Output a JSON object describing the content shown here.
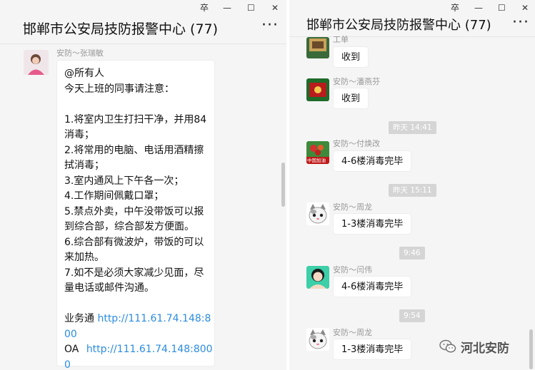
{
  "left_window": {
    "title": "邯郸市公安局技防报警中心 (77)",
    "controls": {
      "pin": "卒",
      "minimize": "—",
      "maximize": "☐",
      "close": "✕"
    },
    "more": "···",
    "message": {
      "sender": "安防～张瑞敏",
      "lines": [
        "@所有人",
        "今天上班的同事请注意：",
        "",
        "1.将室内卫生打扫干净，并用84",
        "消毒；",
        "2.将常用的电脑、电话用酒精擦",
        "拭消毒；",
        "3.室内通风上下午各一次；",
        "4.工作期间佩戴口罩；",
        "5.禁点外卖，中午没带饭可以报",
        "到综合部，综合部发方便面。",
        "6.综合部有微波炉，带饭的可以",
        "来加热。",
        "7.如不是必须大家减少见面，尽",
        "量电话或邮件沟通。",
        ""
      ],
      "link1_label": "业务通",
      "link1_url_a": "http://111.61.74.148:8",
      "link1_url_b": "00",
      "link2_label": "OA",
      "link2_url_a": "http://111.61.74.148:800",
      "link2_url_b": "0"
    }
  },
  "right_window": {
    "title": "邯郸市公安局技防报警中心 (77)",
    "controls": {
      "pin": "卒",
      "minimize": "—",
      "maximize": "☐",
      "close": "✕"
    },
    "more": "···",
    "messages": [
      {
        "sender": "工单",
        "text": "收到"
      },
      {
        "sender": "安防～潘燕芬",
        "text": "收到"
      },
      {
        "timestamp": "昨天 14:41"
      },
      {
        "sender": "安防～付焕改",
        "text": "4-6楼消毒完毕",
        "avatar_caption": "中国加油"
      },
      {
        "timestamp": "昨天 15:11"
      },
      {
        "sender": "安防～周龙",
        "text": "1-3楼消毒完毕"
      },
      {
        "timestamp": "9:46"
      },
      {
        "sender": "安防～闫伟",
        "text": "4-6楼消毒完毕"
      },
      {
        "timestamp": "9:54"
      },
      {
        "sender": "安防～周龙",
        "text": "1-3楼消毒完毕"
      }
    ]
  },
  "watermark": {
    "text": "河北安防"
  }
}
